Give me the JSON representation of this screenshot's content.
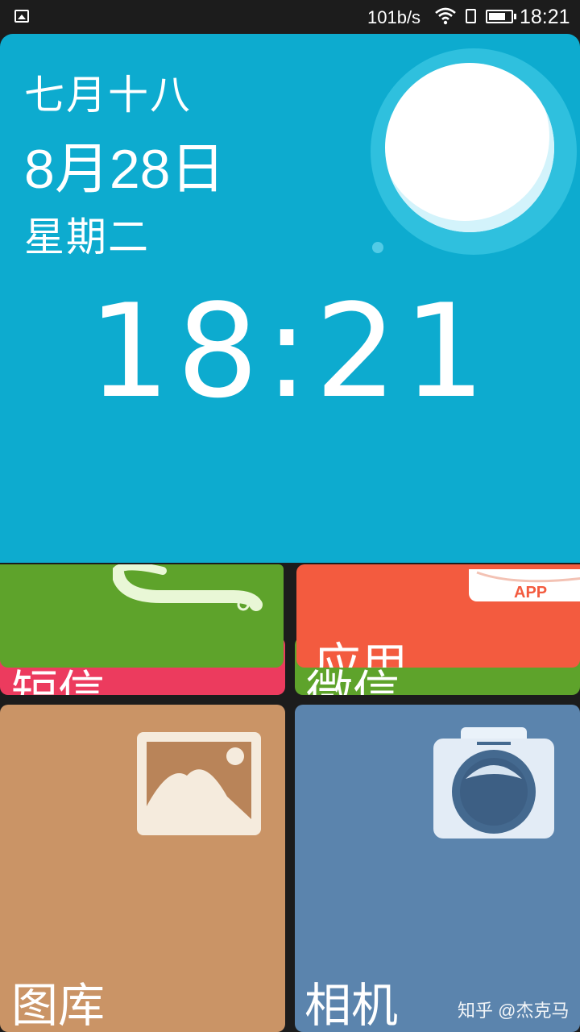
{
  "status_bar": {
    "speed": "101b/s",
    "time": "18:21",
    "battery_level": 0.75,
    "icons": [
      "image-notification-icon",
      "wifi-icon",
      "sim-icon",
      "battery-icon"
    ]
  },
  "clock": {
    "lunar_date": "七月十八",
    "date": "8月28日",
    "weekday": "星期二",
    "time": "18:21",
    "weather_icon": "sun-icon"
  },
  "tiles": {
    "sms_label": "短信",
    "wechat_label": "微信",
    "phone_icon": "phone-handset-icon",
    "apps_label": "应用",
    "apps_badge": "APP",
    "gallery_label": "图库",
    "camera_label": "相机"
  },
  "watermark": "知乎 @杰克马",
  "colors": {
    "clock_bg": "#0dabcf",
    "green": "#5ea32b",
    "red": "#f35b3f",
    "pink": "#ec3b5e",
    "gallery": "#ca9466",
    "camera": "#5b84ad"
  }
}
